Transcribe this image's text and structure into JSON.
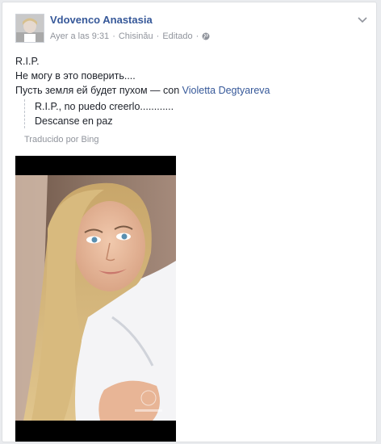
{
  "post": {
    "author": "Vdovenco Anastasia",
    "time": "Ayer a las 9:31",
    "location": "Chisinău",
    "edited": "Editado",
    "privacy_icon": "globe-icon",
    "menu_icon": "chevron-down-icon"
  },
  "body": {
    "line1": "R.I.P.",
    "line2": "Не могу в это поверить....",
    "line3": "Пусть земля ей будет пухом — con ",
    "tagged": "Violetta Degtyareva"
  },
  "translation": {
    "line1": "R.I.P., no puedo creerlo............",
    "line2": "Descanse en paz",
    "credit": "Traducido por Bing"
  },
  "colors": {
    "link": "#365899",
    "meta": "#90949c",
    "background": "#e9ebee"
  }
}
